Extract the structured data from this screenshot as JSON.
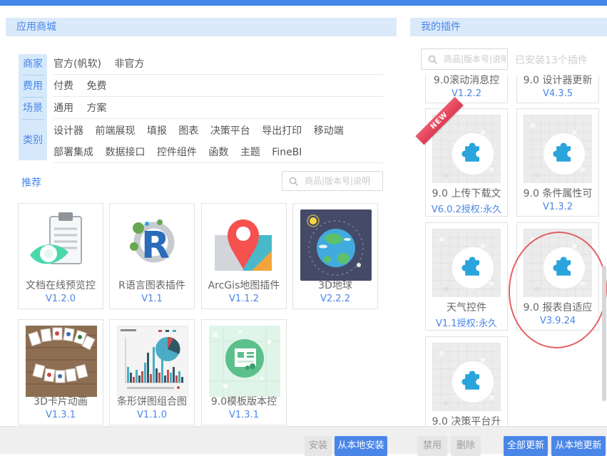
{
  "colors": {
    "topbar_blue": "#4486e8",
    "accent_blue": "#4a86e8",
    "header_bg": "#dbeafa",
    "puzzle_blue": "#29a4dc",
    "ribbon_red": "#dd3a52",
    "annotation_red": "#df4646"
  },
  "store_panel": {
    "title": "应用商城",
    "filters": [
      {
        "label": "商家",
        "options": [
          "官方(帆软)",
          "非官方"
        ]
      },
      {
        "label": "费用",
        "options": [
          "付费",
          "免费"
        ]
      },
      {
        "label": "场景",
        "options": [
          "通用",
          "方案"
        ]
      },
      {
        "label": "类别",
        "options": [
          "设计器",
          "前端展现",
          "填报",
          "图表",
          "决策平台",
          "导出打印",
          "移动端",
          "部署集成",
          "数据接口",
          "控件组件",
          "函数",
          "主题",
          "FineBI"
        ]
      }
    ],
    "recommend_label": "推荐",
    "search_placeholder": "商品|版本号|说明",
    "cards": [
      {
        "title": "文档在线预览控",
        "version": "V1.2.0",
        "icon": "document-preview-icon"
      },
      {
        "title": "R语言图表插件",
        "version": "V1.1",
        "icon": "r-language-icon"
      },
      {
        "title": "ArcGis地图插件",
        "version": "V1.1.2",
        "icon": "map-pin-icon"
      },
      {
        "title": "3D地球",
        "version": "V2.2.2",
        "icon": "earth-icon"
      },
      {
        "title": "3D卡片动画",
        "version": "V1.3.1",
        "icon": "cards-3d-icon"
      },
      {
        "title": "条形饼图组合图",
        "version": "V1.1.0",
        "icon": "bar-pie-chart-icon"
      },
      {
        "title": "9.0模板版本控",
        "version": "V1.3.1",
        "icon": "template-version-icon"
      }
    ],
    "footer": {
      "install_label": "安装",
      "install_local_label": "从本地安装"
    }
  },
  "plugins_panel": {
    "title": "我的插件",
    "search_placeholder": "商品|版本号|说明",
    "installed_count_text": "已安装13个插件",
    "badge_new": "NEW",
    "cards": [
      {
        "title": "9.0滚动消息控",
        "version": "V1.2.2"
      },
      {
        "title": "9.0 设计器更新",
        "version": "V4.3.5"
      },
      {
        "title": "9.0 上传下载文",
        "version": "V6.0.2授权:永久"
      },
      {
        "title": "9.0 条件属性可",
        "version": "V1.3.2"
      },
      {
        "title": "天气控件",
        "version": "V1.1授权:永久"
      },
      {
        "title": "9.0 报表自适应",
        "version": "V3.9.24"
      },
      {
        "title": "9.0 决策平台升",
        "version": ""
      }
    ],
    "footer": {
      "disable_label": "禁用",
      "delete_label": "删除",
      "update_all_label": "全部更新",
      "update_local_label": "从本地更新"
    }
  }
}
